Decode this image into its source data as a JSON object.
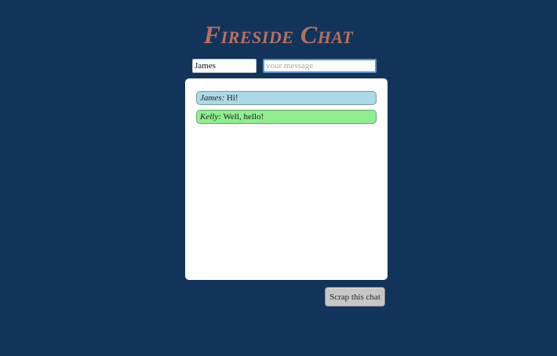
{
  "title": "Fireside Chat",
  "form": {
    "name_value": "James",
    "message_placeholder": "your message",
    "message_value": ""
  },
  "messages": [
    {
      "author": "James:",
      "text": "Hi!",
      "color": "#add8e6"
    },
    {
      "author": "Kelly:",
      "text": "Well, hello!",
      "color": "#90ee90"
    }
  ],
  "actions": {
    "scrap_label": "Scrap this chat"
  },
  "colors": {
    "background": "#13345a",
    "title": "#b8705e",
    "panel": "#ffffff"
  }
}
